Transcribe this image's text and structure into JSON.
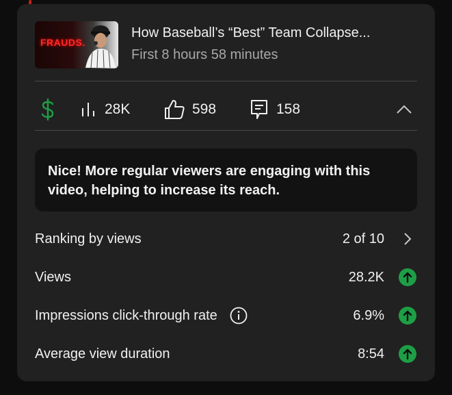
{
  "colors": {
    "background": "#0d0d0d",
    "card": "#212121",
    "info_box": "#121212",
    "accent_green": "#1e9e46",
    "subtext": "#a8a8a8"
  },
  "video": {
    "thumbnail_text": "FRAUDS.",
    "title": "How Baseball’s “Best” Team Collapse...",
    "subtitle": "First 8 hours 58 minutes"
  },
  "stats": {
    "revenue_icon": "dollar-icon",
    "views": "28K",
    "likes": "598",
    "comments": "158"
  },
  "insight": {
    "message": "Nice! More regular viewers are engaging with this video, helping to increase its reach."
  },
  "metrics": [
    {
      "label": "Ranking by views",
      "value": "2 of 10",
      "trailing": "chevron-right-icon"
    },
    {
      "label": "Views",
      "value": "28.2K",
      "trailing": "arrow-up-icon"
    },
    {
      "label": "Impressions click-through rate",
      "value": "6.9%",
      "trailing": "arrow-up-icon",
      "has_info": true
    },
    {
      "label": "Average view duration",
      "value": "8:54",
      "trailing": "arrow-up-icon"
    }
  ]
}
